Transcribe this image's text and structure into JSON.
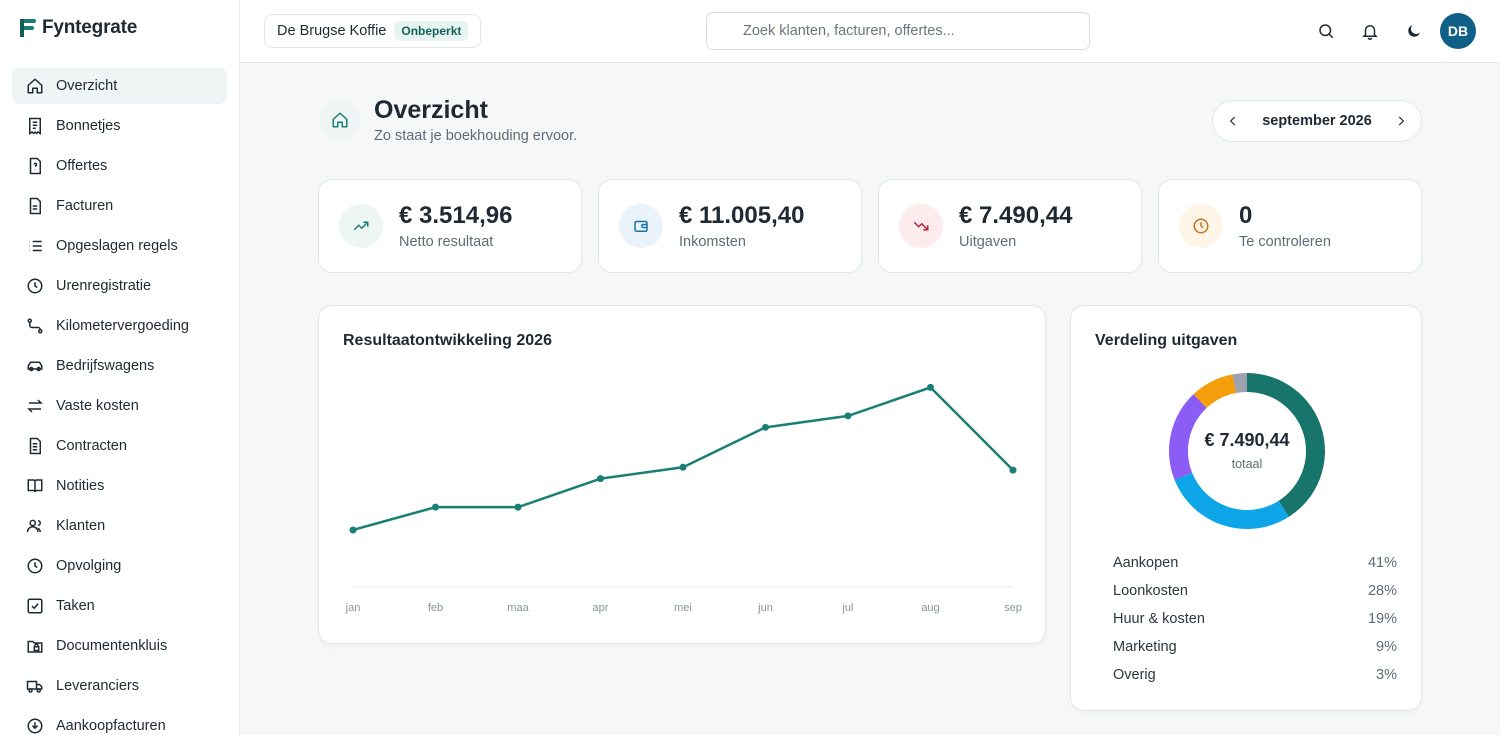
{
  "app": {
    "name": "Fyntegrate"
  },
  "sidebar": {
    "items": [
      {
        "label": "Overzicht",
        "icon": "home-icon",
        "active": true
      },
      {
        "label": "Bonnetjes",
        "icon": "receipt-icon"
      },
      {
        "label": "Offertes",
        "icon": "quote-icon"
      },
      {
        "label": "Facturen",
        "icon": "invoice-icon"
      },
      {
        "label": "Opgeslagen regels",
        "icon": "list-icon"
      },
      {
        "label": "Urenregistratie",
        "icon": "clock-icon"
      },
      {
        "label": "Kilometervergoeding",
        "icon": "route-icon"
      },
      {
        "label": "Bedrijfswagens",
        "icon": "car-icon"
      },
      {
        "label": "Vaste kosten",
        "icon": "arrows-icon"
      },
      {
        "label": "Contracten",
        "icon": "document-icon"
      },
      {
        "label": "Notities",
        "icon": "book-icon"
      },
      {
        "label": "Klanten",
        "icon": "users-icon"
      },
      {
        "label": "Opvolging",
        "icon": "clock-icon"
      },
      {
        "label": "Taken",
        "icon": "checkbox-icon"
      },
      {
        "label": "Documentenkluis",
        "icon": "folder-lock-icon"
      },
      {
        "label": "Leveranciers",
        "icon": "truck-icon"
      },
      {
        "label": "Aankoopfacturen",
        "icon": "download-circle-icon"
      }
    ]
  },
  "topbar": {
    "company": "De Brugse Koffie",
    "plan_badge": "Onbeperkt",
    "search_placeholder": "Zoek klanten, facturen, offertes...",
    "avatar_initials": "DB"
  },
  "header": {
    "title": "Overzicht",
    "subtitle": "Zo staat je boekhouding ervoor.",
    "month": "september 2026"
  },
  "kpis": [
    {
      "value": "€ 3.514,96",
      "label": "Netto resultaat",
      "icon": "trending-up-icon",
      "color": "#1a7f74",
      "bg": "#eef6f4"
    },
    {
      "value": "€ 11.005,40",
      "label": "Inkomsten",
      "icon": "wallet-icon",
      "color": "#1273a8",
      "bg": "#eaf3f9"
    },
    {
      "value": "€ 7.490,44",
      "label": "Uitgaven",
      "icon": "trending-down-icon",
      "color": "#c0223a",
      "bg": "#fcecee"
    },
    {
      "value": "0",
      "label": "Te controleren",
      "icon": "clock-icon",
      "color": "#c8741a",
      "bg": "#fdf5e8"
    }
  ],
  "result_chart": {
    "title": "Resultaatontwikkeling 2026",
    "chart_data": {
      "type": "line",
      "categories": [
        "jan",
        "feb",
        "maa",
        "apr",
        "mei",
        "jun",
        "jul",
        "aug",
        "sep"
      ],
      "values": [
        1000,
        1400,
        1400,
        1900,
        2100,
        2800,
        3000,
        3500,
        2050
      ],
      "color": "#1a7f74"
    }
  },
  "expense_chart": {
    "title": "Verdeling uitgaven",
    "total": "€ 7.490,44",
    "total_label": "totaal",
    "chart_data": {
      "type": "pie",
      "categories": [
        "Aankopen",
        "Loonkosten",
        "Huur & kosten",
        "Marketing",
        "Overig"
      ],
      "values": [
        41,
        28,
        19,
        9,
        3
      ],
      "colors": [
        "#17756b",
        "#0ea5e9",
        "#8b5cf6",
        "#f59e0b",
        "#9ca3af"
      ]
    },
    "legend": [
      {
        "label": "Aankopen",
        "pct": "41%"
      },
      {
        "label": "Loonkosten",
        "pct": "28%"
      },
      {
        "label": "Huur & kosten",
        "pct": "19%"
      },
      {
        "label": "Marketing",
        "pct": "9%"
      },
      {
        "label": "Overig",
        "pct": "3%"
      }
    ]
  }
}
